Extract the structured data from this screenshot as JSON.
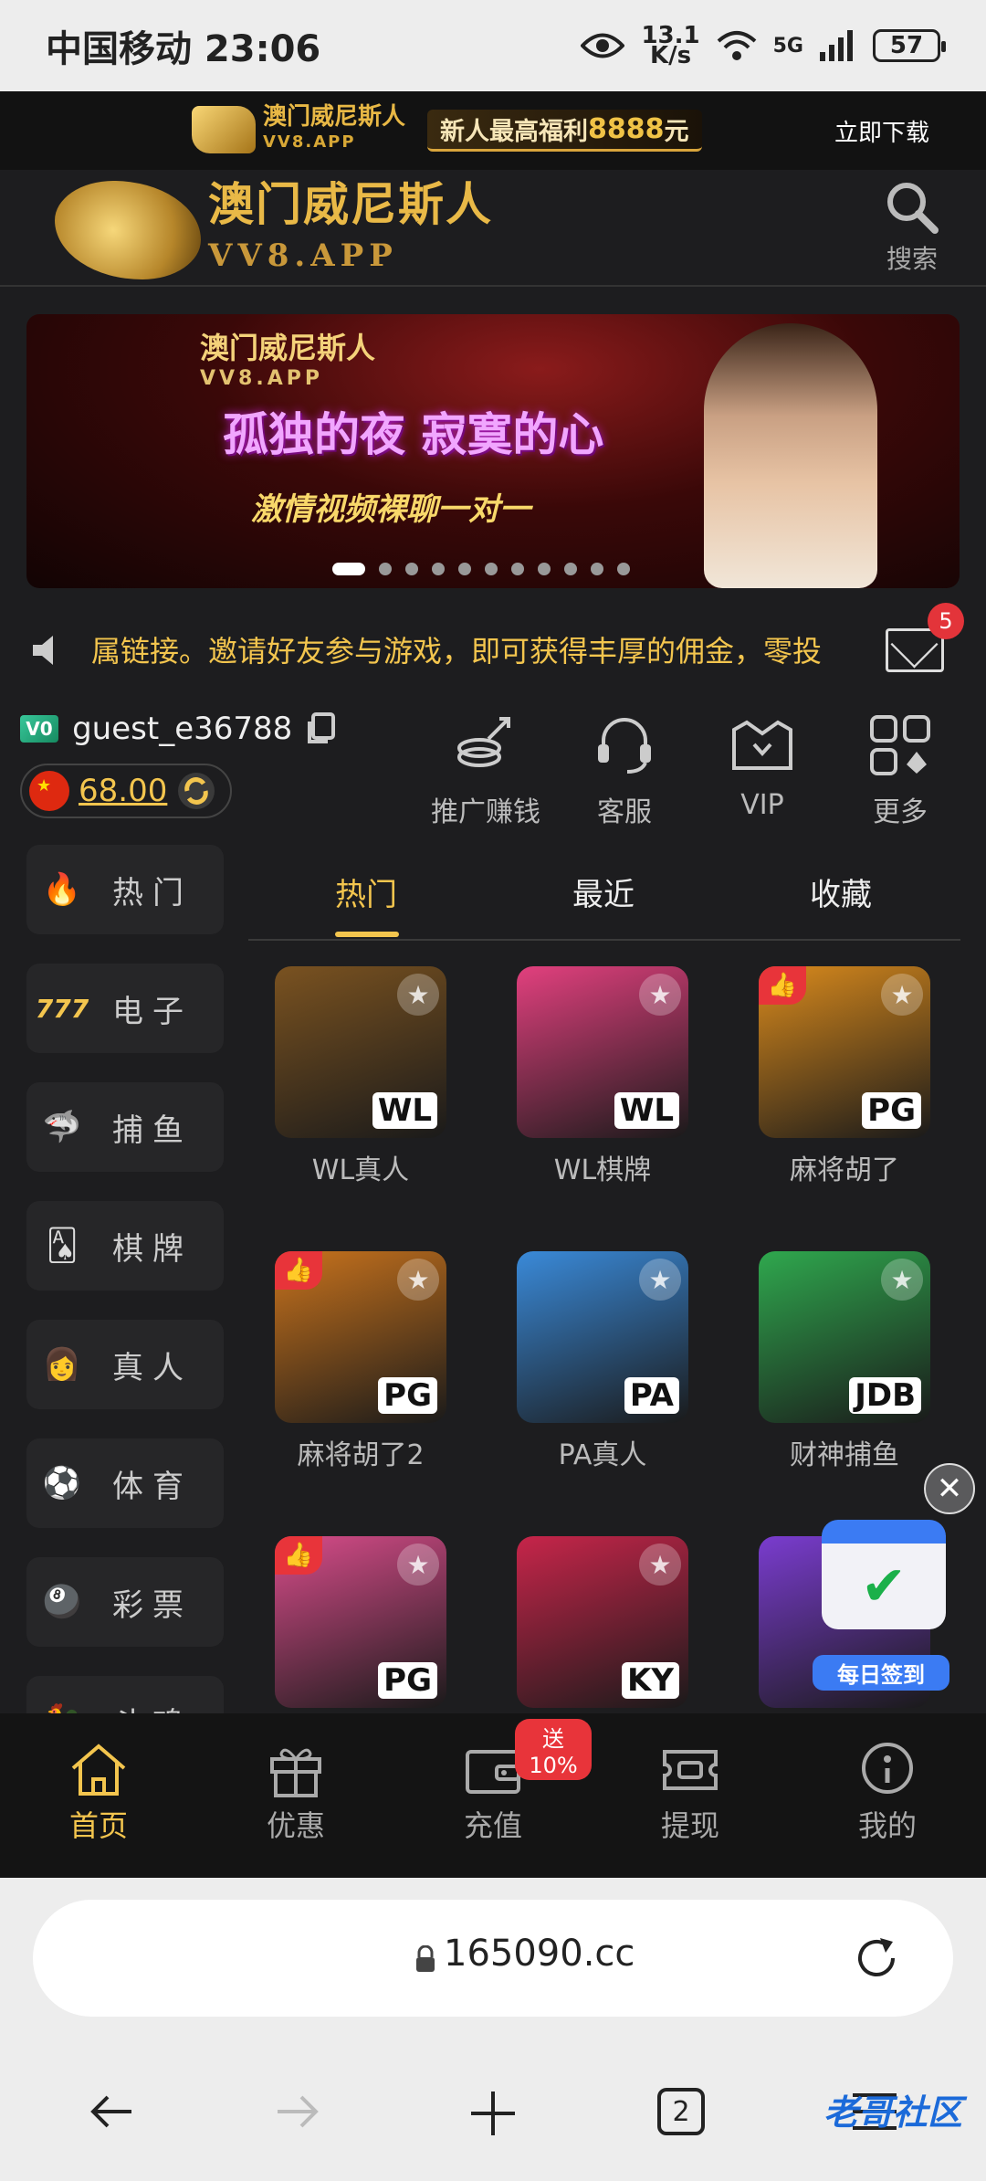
{
  "status_bar": {
    "carrier_time": "中国移动 23:06",
    "net_speed_value": "13.1",
    "net_speed_unit": "K/s",
    "network": "5G",
    "battery": "57"
  },
  "promo_bar": {
    "logo_name": "澳门威尼斯人",
    "logo_domain": "VV8.APP",
    "slogan_prefix": "新人最高福利",
    "slogan_amount": "8888",
    "slogan_suffix": "元",
    "download": "立即下载"
  },
  "header": {
    "brand_name": "澳门威尼斯人",
    "brand_domain": "VV8.APP",
    "search_label": "搜索"
  },
  "banner": {
    "logo_name": "澳门威尼斯人",
    "logo_domain": "VV8.APP",
    "headline": "孤独的夜 寂寞的心",
    "subline": "激情视频裸聊一对一",
    "dot_count": 11,
    "active_dot": 0
  },
  "notice": {
    "message": "属链接。邀请好友参与游戏，即可获得丰厚的佣金，零投",
    "mail_badge": "5"
  },
  "user": {
    "vip_level": "V0",
    "username": "guest_e36788",
    "balance": "68.00"
  },
  "quick_actions": [
    {
      "label": "推广赚钱",
      "icon": "coins-icon"
    },
    {
      "label": "客服",
      "icon": "headset-icon"
    },
    {
      "label": "VIP",
      "icon": "crown-icon"
    },
    {
      "label": "更多",
      "icon": "more-grid-icon"
    }
  ],
  "sidebar": [
    {
      "label": "热门",
      "icon": "fire-icon"
    },
    {
      "label": "电子",
      "icon": "slot-777-icon"
    },
    {
      "label": "捕鱼",
      "icon": "shark-icon"
    },
    {
      "label": "棋牌",
      "icon": "cards-icon"
    },
    {
      "label": "真人",
      "icon": "dealer-icon"
    },
    {
      "label": "体育",
      "icon": "soccer-icon"
    },
    {
      "label": "彩票",
      "icon": "lottery-balls-icon"
    },
    {
      "label": "斗鸡",
      "icon": "rooster-icon"
    }
  ],
  "tabs": [
    {
      "label": "热门",
      "active": true
    },
    {
      "label": "最近",
      "active": false
    },
    {
      "label": "收藏",
      "active": false
    }
  ],
  "games": [
    {
      "name": "WL真人",
      "provider": "WL",
      "liked": false,
      "color": "#7a5220"
    },
    {
      "name": "WL棋牌",
      "provider": "WL",
      "liked": false,
      "color": "#e2407e"
    },
    {
      "name": "麻将胡了",
      "provider": "PG",
      "liked": true,
      "color": "#d98a1c"
    },
    {
      "name": "麻将胡了2",
      "provider": "PG",
      "liked": true,
      "color": "#c9731c"
    },
    {
      "name": "PA真人",
      "provider": "PA",
      "liked": false,
      "color": "#3a8ad9"
    },
    {
      "name": "财神捕鱼",
      "provider": "JDB",
      "liked": false,
      "color": "#2fa84e"
    },
    {
      "name": "",
      "provider": "PG",
      "liked": true,
      "color": "#d84c8a"
    },
    {
      "name": "",
      "provider": "KY",
      "liked": false,
      "color": "#c7254a"
    },
    {
      "name": "",
      "provider": "",
      "liked": false,
      "color": "#7a3ccf"
    }
  ],
  "floating": {
    "close": "✕",
    "checkin_label": "每日签到"
  },
  "bottom_nav": [
    {
      "label": "首页",
      "icon": "home-icon",
      "active": true
    },
    {
      "label": "优惠",
      "icon": "gift-icon",
      "active": false
    },
    {
      "label": "充值",
      "icon": "wallet-icon",
      "active": false,
      "badge": "送10%"
    },
    {
      "label": "提现",
      "icon": "withdraw-ticket-icon",
      "active": false
    },
    {
      "label": "我的",
      "icon": "user-icon",
      "active": false
    }
  ],
  "browser": {
    "url": "165090.cc",
    "tab_count": "2",
    "watermark": "老哥社区"
  },
  "colors": {
    "accent": "#f3c54e",
    "background": "#1d1d1f",
    "badge_red": "#e8343a"
  }
}
